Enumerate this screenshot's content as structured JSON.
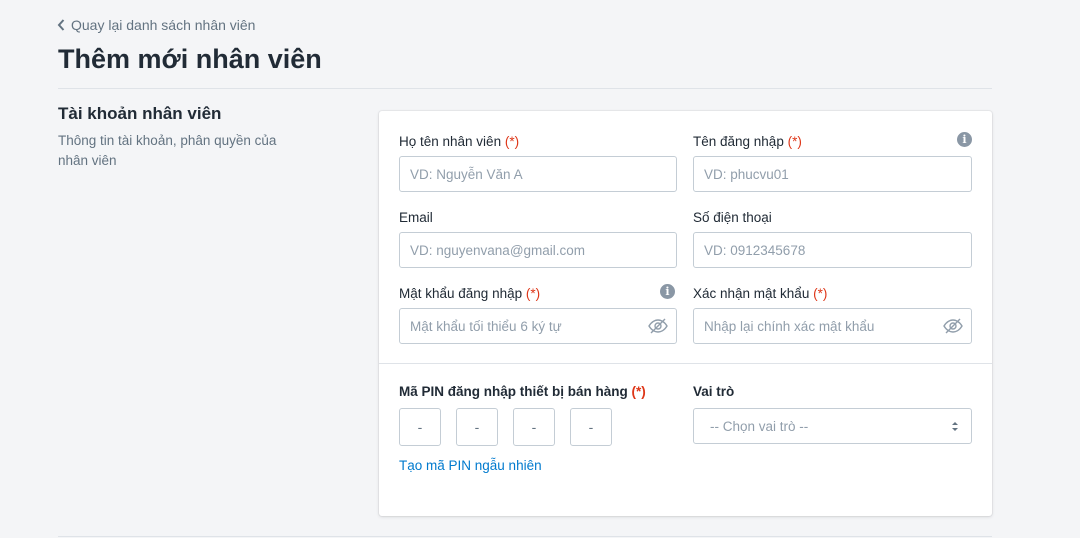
{
  "back_link": "Quay lại danh sách nhân viên",
  "page_title": "Thêm mới nhân viên",
  "section": {
    "title": "Tài khoản nhân viên",
    "description": "Thông tin tài khoản, phân quyền của nhân viên"
  },
  "fields": {
    "fullname": {
      "label": "Họ tên nhân viên",
      "required": "(*)",
      "placeholder": "VD: Nguyễn Văn A"
    },
    "username": {
      "label": "Tên đăng nhập",
      "required": "(*)",
      "placeholder": "VD: phucvu01"
    },
    "email": {
      "label": "Email",
      "placeholder": "VD: nguyenvana@gmail.com"
    },
    "phone": {
      "label": "Số điện thoại",
      "placeholder": "VD: 0912345678"
    },
    "password": {
      "label": "Mật khẩu đăng nhập",
      "required": "(*)",
      "placeholder": "Mật khẩu tối thiểu 6 ký tự"
    },
    "confirm_password": {
      "label": "Xác nhận mật khẩu",
      "required": "(*)",
      "placeholder": "Nhập lại chính xác mật khẩu"
    }
  },
  "pin": {
    "label": "Mã PIN đăng nhập thiết bị bán hàng",
    "required": "(*)",
    "digits": [
      "-",
      "-",
      "-",
      "-"
    ],
    "random_link": "Tạo mã PIN ngẫu nhiên"
  },
  "role": {
    "label": "Vai trò",
    "selected": "-- Chọn vai trò --"
  },
  "icons": {
    "info": "i",
    "back": "chevron-left-icon",
    "eye": "eye-slash-icon",
    "select": "select-arrows-icon"
  },
  "colors": {
    "accent": "#007ace",
    "required": "#de3618",
    "background": "#f4f5f7"
  }
}
